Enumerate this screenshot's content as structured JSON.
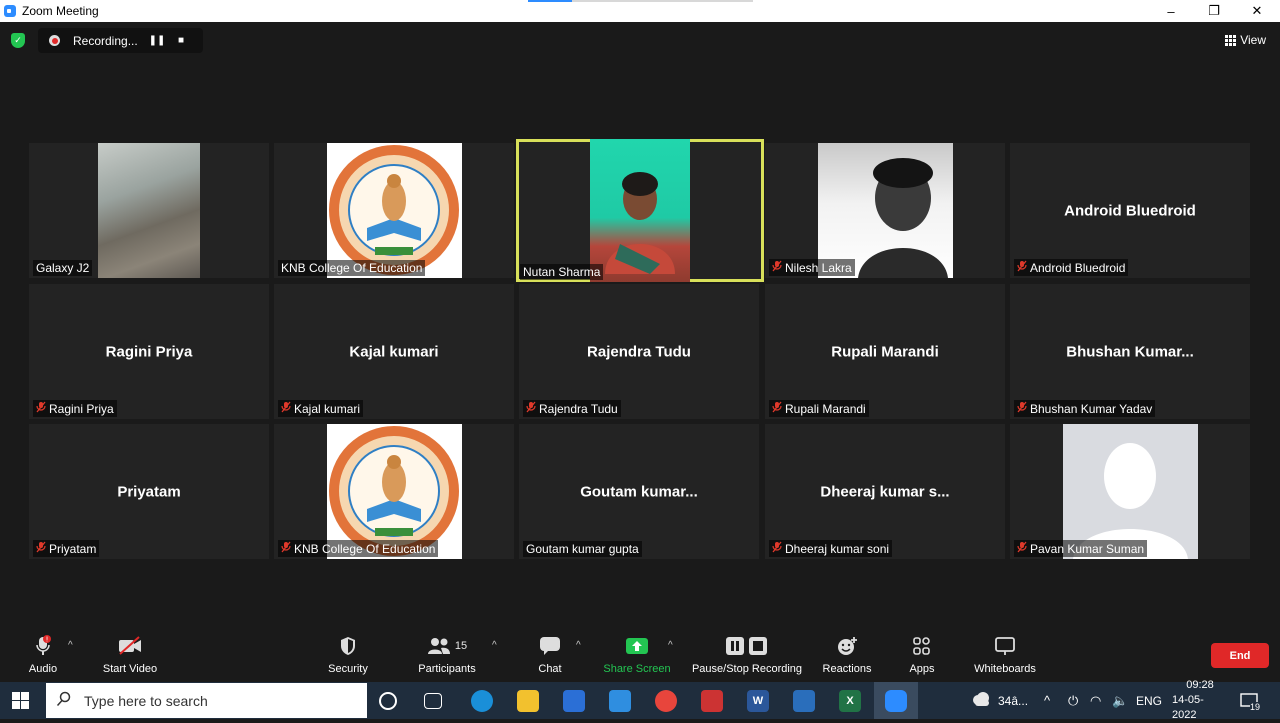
{
  "window": {
    "title": "Zoom Meeting",
    "minimize": "–",
    "restore": "❐",
    "close": "✕"
  },
  "recording": {
    "label": "Recording...",
    "pause": "❚❚",
    "stop": "■"
  },
  "view_label": "View",
  "tiles": [
    {
      "name": "Galaxy J2",
      "center": "",
      "muted": false,
      "photo": "camera-dark"
    },
    {
      "name": "KNB College Of Education",
      "center": "",
      "muted": false,
      "photo": "college-logo"
    },
    {
      "name": "Nutan Sharma",
      "center": "",
      "muted": false,
      "photo": "video-feed",
      "active": true
    },
    {
      "name": "Nilesh Lakra",
      "center": "",
      "muted": true,
      "photo": "profile-photo"
    },
    {
      "name": "Android Bluedroid",
      "center": "Android Bluedroid",
      "muted": true
    },
    {
      "name": "Ragini Priya",
      "center": "Ragini Priya",
      "muted": true
    },
    {
      "name": "Kajal kumari",
      "center": "Kajal kumari",
      "muted": true
    },
    {
      "name": "Rajendra Tudu",
      "center": "Rajendra Tudu",
      "muted": true
    },
    {
      "name": "Rupali Marandi",
      "center": "Rupali Marandi",
      "muted": true
    },
    {
      "name": "Bhushan Kumar Yadav",
      "center": "Bhushan  Kumar...",
      "muted": true
    },
    {
      "name": "Priyatam",
      "center": "Priyatam",
      "muted": true
    },
    {
      "name": "KNB College Of Education",
      "center": "",
      "muted": true,
      "photo": "college-logo"
    },
    {
      "name": "Goutam kumar gupta",
      "center": "Goutam  kumar...",
      "muted": false
    },
    {
      "name": "Dheeraj kumar soni",
      "center": "Dheeraj  kumar s...",
      "muted": true
    },
    {
      "name": "Pavan Kumar Suman",
      "center": "",
      "muted": true,
      "photo": "default-avatar"
    }
  ],
  "toolbar": {
    "audio": "Audio",
    "start_video": "Start Video",
    "security": "Security",
    "participants": "Participants",
    "participants_count": "15",
    "chat": "Chat",
    "share_screen": "Share Screen",
    "recording": "Pause/Stop Recording",
    "reactions": "Reactions",
    "apps": "Apps",
    "whiteboards": "Whiteboards",
    "end": "End"
  },
  "taskbar": {
    "search_placeholder": "Type here to search",
    "weather": "34â...",
    "language": "ENG",
    "time": "09:28",
    "date": "14-05-2022",
    "notifications": "19"
  },
  "colors": {
    "active_speaker": "#d8e05a",
    "share_green": "#23c552",
    "end_red": "#e02828",
    "muted_red": "#e0392b"
  }
}
